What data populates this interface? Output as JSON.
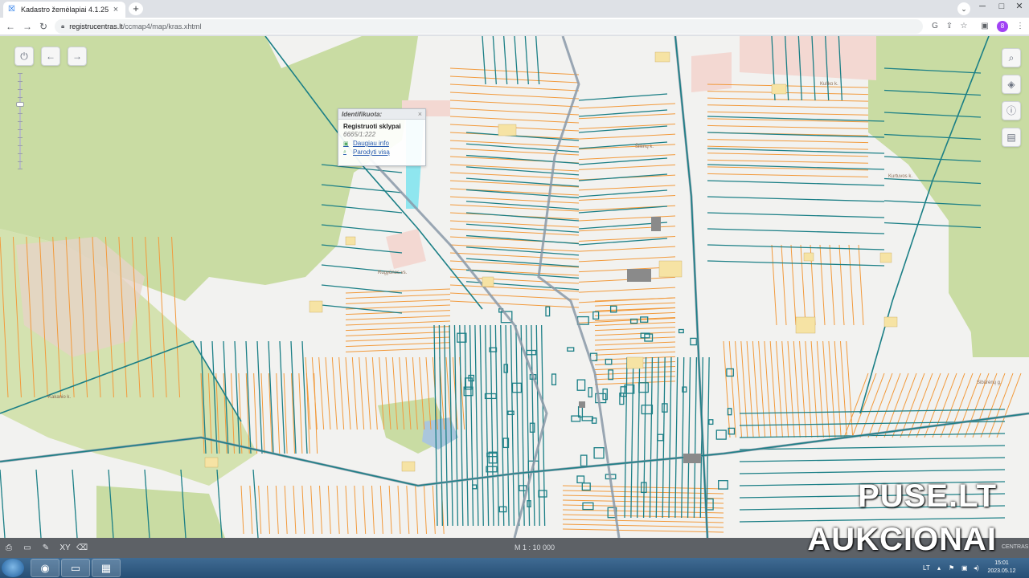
{
  "browser": {
    "tab_title": "Kadastro žemėlapiai 4.1.25",
    "tab_close": "×",
    "new_tab": "+",
    "tab_menu": "⌄",
    "win_min": "─",
    "win_max": "□",
    "win_close": "✕",
    "url_host": "registrucentras.lt",
    "url_path": "/ccmap4/map/kras.xhtml",
    "profile_initial": "8"
  },
  "map": {
    "toolbar_buttons": [
      {
        "name": "power-icon",
        "glyph": "⏻"
      },
      {
        "name": "back-arrow-icon",
        "glyph": "←"
      },
      {
        "name": "forward-arrow-icon",
        "glyph": "→"
      }
    ],
    "right_buttons": [
      {
        "name": "search-icon",
        "glyph": "🔍︎"
      },
      {
        "name": "layers-icon",
        "glyph": "◈"
      },
      {
        "name": "info-icon",
        "glyph": "ⓘ"
      },
      {
        "name": "document-icon",
        "glyph": "▤"
      }
    ],
    "popup": {
      "header": "Identifikuota:",
      "close": "×",
      "title": "Registruoti sklypai",
      "value": "6665/1:222",
      "link_more": "Daugiau info",
      "link_show_all": "Parodyti visą"
    },
    "place_labels": [
      "Rugyūnos vs.",
      "Kuliko k.",
      "Šilėnų k.",
      "Kurtuvos k.",
      "Kakanio k.",
      "Sibūrėnų g."
    ],
    "colors": {
      "parcel_blue": "#1b7f86",
      "parcel_orange": "#f29a3c",
      "forest_green": "#c9dca3",
      "background": "#f2f2f0"
    }
  },
  "statusbar": {
    "scale": "M 1 : 10 000",
    "brand": "CENTRAS",
    "xy_label": "XY"
  },
  "watermark": {
    "line1": "PUSE.LT",
    "line2": "AUKCIONAI"
  },
  "taskbar": {
    "language": "LT",
    "time": "15:01",
    "date": "2023.05.12"
  }
}
